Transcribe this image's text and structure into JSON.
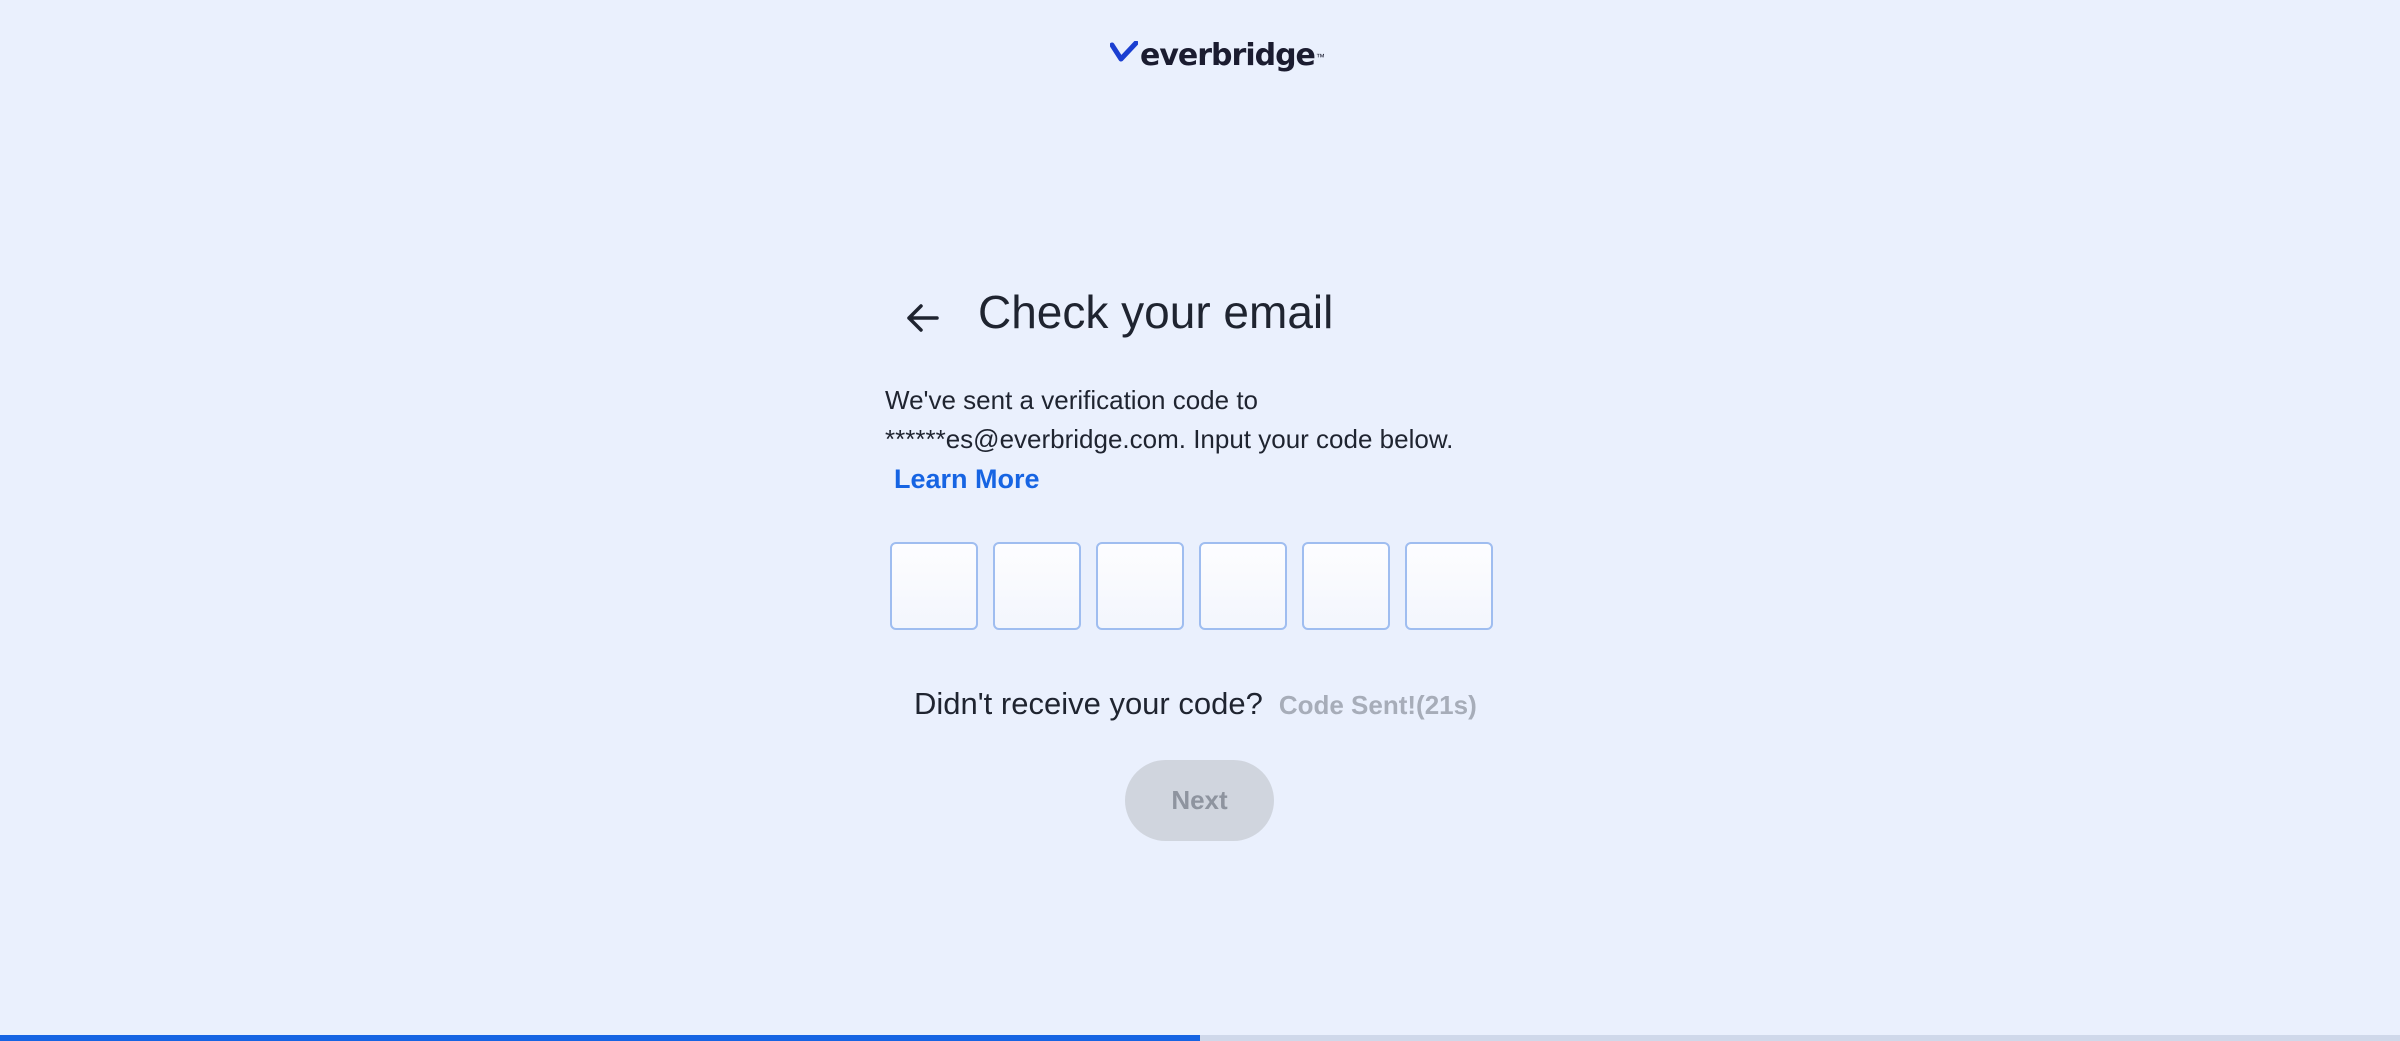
{
  "logo": {
    "text": "everbridge",
    "tm": "™",
    "icon": "everbridge-checkmark-logo"
  },
  "header": {
    "back_icon": "arrow-left-icon",
    "title": "Check your email"
  },
  "description": {
    "line1": "We've sent a verification code to",
    "line2": "******es@everbridge.com. Input your code below."
  },
  "learn_more": "Learn More",
  "code_inputs": [
    "",
    "",
    "",
    "",
    "",
    ""
  ],
  "resend": {
    "label": "Didn't receive your code?",
    "status": "Code Sent!(21s)"
  },
  "next_label": "Next",
  "progress": {
    "fraction": 0.5
  },
  "colors": {
    "background": "#eaf0fd",
    "accent": "#1664e3",
    "disabled_button": "#d0d5de",
    "disabled_text": "#a7adb9"
  }
}
